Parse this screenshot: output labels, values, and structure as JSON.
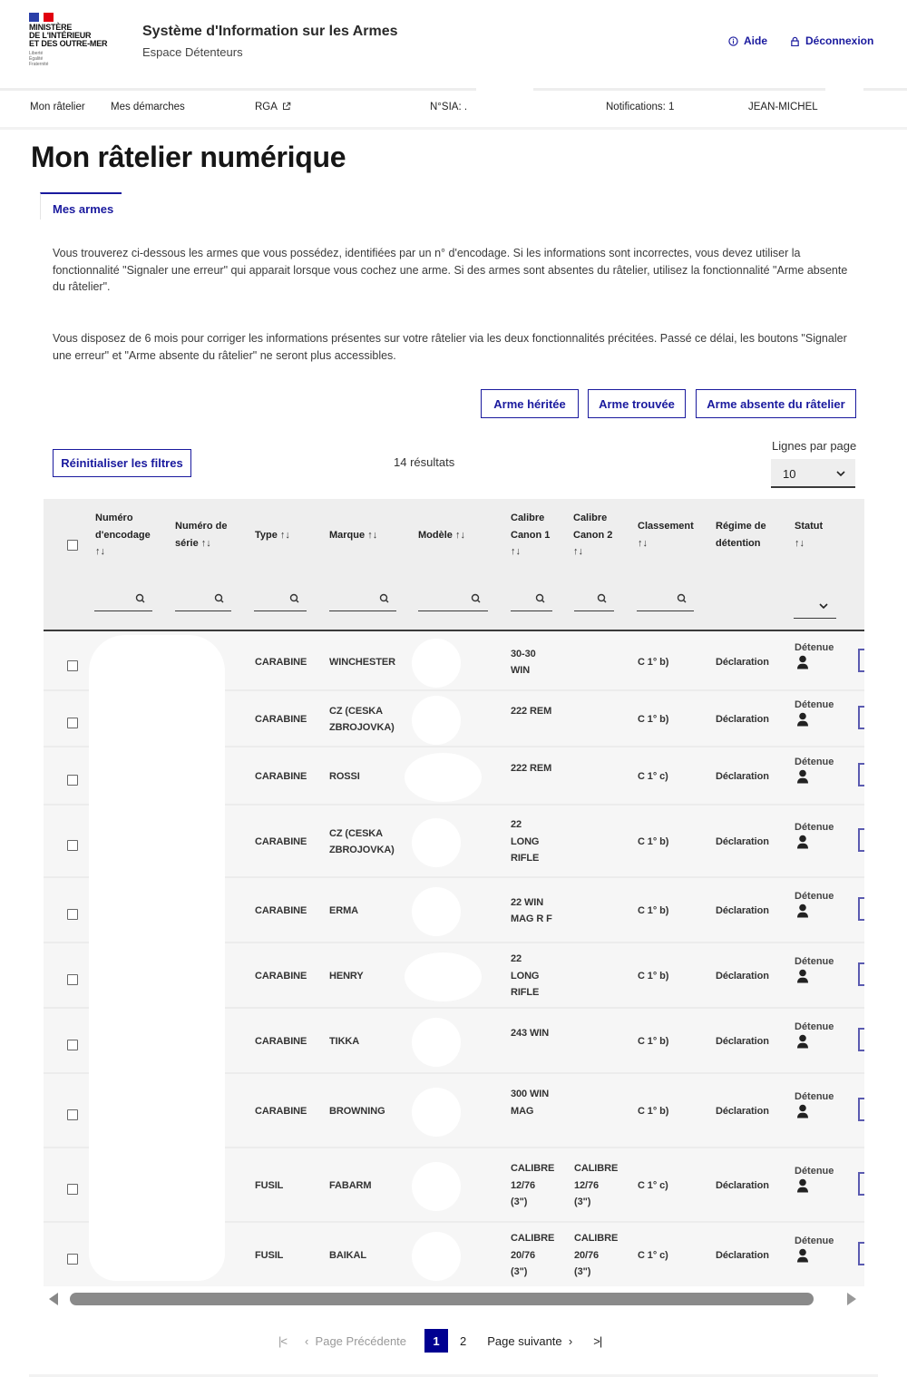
{
  "header": {
    "logo_lines": [
      "MINISTÈRE",
      "DE L'INTÉRIEUR",
      "ET DES OUTRE-MER"
    ],
    "logo_motto": [
      "Liberté",
      "Égalité",
      "Fraternité"
    ],
    "site_title": "Système d'Information sur les Armes",
    "site_subtitle": "Espace Détenteurs",
    "help_label": "Aide",
    "logout_label": "Déconnexion"
  },
  "nav": {
    "items": [
      {
        "label": "Mon râtelier"
      },
      {
        "label": "Mes démarches"
      },
      {
        "label": "RGA"
      }
    ],
    "sia_label": "N°SIA: .",
    "notifications_label": "Notifications: 1",
    "user_name": "JEAN-MICHEL"
  },
  "page": {
    "title": "Mon râtelier numérique",
    "tab_label": "Mes armes",
    "paragraph_1": "Vous trouverez ci-dessous les armes que vous possédez, identifiées par un n° d'encodage. Si les informations sont incorrectes, vous devez utiliser la fonctionnalité \"Signaler une erreur\" qui apparait lorsque vous cochez une arme. Si des armes sont absentes du râtelier, utilisez la fonctionnalité \"Arme absente du râtelier\".",
    "paragraph_2": "Vous disposez de 6 mois pour corriger les informations présentes sur votre râtelier via les deux fonctionnalités précitées. Passé ce délai, les boutons \"Signaler une erreur\" et \"Arme absente du râtelier\" ne seront plus accessibles."
  },
  "actions": {
    "inherited_label": "Arme héritée",
    "found_label": "Arme trouvée",
    "missing_label": "Arme absente du râtelier",
    "reset_filters_label": "Réinitialiser les filtres"
  },
  "results": {
    "count_label": "14 résultats",
    "lines_per_page_label": "Lignes par page",
    "lines_per_page_value": "10"
  },
  "table": {
    "columns": [
      {
        "label": "Numéro d'encodage",
        "sort": "↑↓"
      },
      {
        "label": "Numéro de série",
        "sort": "↑↓"
      },
      {
        "label": "Type",
        "sort": "↑↓"
      },
      {
        "label": "Marque",
        "sort": "↑↓"
      },
      {
        "label": "Modèle",
        "sort": "↑↓"
      },
      {
        "label": "Calibre Canon 1",
        "sort": "↑↓"
      },
      {
        "label": "Calibre Canon 2",
        "sort": "↑↓"
      },
      {
        "label": "Classement",
        "sort": "↑↓"
      },
      {
        "label": "Régime de détention",
        "sort": ""
      },
      {
        "label": "Statut",
        "sort": "↑↓"
      }
    ],
    "rows": [
      {
        "type": "CARABINE",
        "marque": "WINCHESTER",
        "calibre1": "30-30 WIN",
        "calibre2": "",
        "classement": "C 1° b)",
        "regime": "Déclaration",
        "statut": "Détenue"
      },
      {
        "type": "CARABINE",
        "marque": "CZ (CESKA ZBROJOVKA)",
        "calibre1": "222 REM",
        "calibre2": "",
        "classement": "C 1° b)",
        "regime": "Déclaration",
        "statut": "Détenue"
      },
      {
        "type": "CARABINE",
        "marque": "ROSSI",
        "calibre1": "222 REM",
        "calibre2": "",
        "classement": "C 1° c)",
        "regime": "Déclaration",
        "statut": "Détenue"
      },
      {
        "type": "CARABINE",
        "marque": "CZ (CESKA ZBROJOVKA)",
        "calibre1": "22 LONG RIFLE",
        "calibre2": "",
        "classement": "C 1° b)",
        "regime": "Déclaration",
        "statut": "Détenue"
      },
      {
        "type": "CARABINE",
        "marque": "ERMA",
        "calibre1": "22 WIN MAG R F",
        "calibre2": "",
        "classement": "C 1° b)",
        "regime": "Déclaration",
        "statut": "Détenue"
      },
      {
        "type": "CARABINE",
        "marque": "HENRY",
        "calibre1": "22 LONG RIFLE",
        "calibre2": "",
        "classement": "C 1° b)",
        "regime": "Déclaration",
        "statut": "Détenue"
      },
      {
        "type": "CARABINE",
        "marque": "TIKKA",
        "calibre1": "243 WIN",
        "calibre2": "",
        "classement": "C 1° b)",
        "regime": "Déclaration",
        "statut": "Détenue"
      },
      {
        "type": "CARABINE",
        "marque": "BROWNING",
        "calibre1": "300 WIN MAG",
        "calibre2": "",
        "classement": "C 1° b)",
        "regime": "Déclaration",
        "statut": "Détenue"
      },
      {
        "type": "FUSIL",
        "marque": "FABARM",
        "calibre1": "CALIBRE 12/76 (3\")",
        "calibre2": "CALIBRE 12/76 (3\")",
        "classement": "C 1° c)",
        "regime": "Déclaration",
        "statut": "Détenue"
      },
      {
        "type": "FUSIL",
        "marque": "BAIKAL",
        "calibre1": "CALIBRE 20/76 (3\")",
        "calibre2": "CALIBRE 20/76 (3\")",
        "classement": "C 1° c)",
        "regime": "Déclaration",
        "statut": "Détenue"
      }
    ]
  },
  "pagination": {
    "first_symbol": "|<",
    "prev_label": "Page Précédente",
    "pages": [
      "1",
      "2"
    ],
    "current_page": "1",
    "next_label": "Page suivante",
    "last_symbol": ">|"
  },
  "colors": {
    "primary": "#000091",
    "link": "#1a1a9e",
    "table_bg": "#f6f6f6",
    "header_bg": "#eeeeee"
  }
}
